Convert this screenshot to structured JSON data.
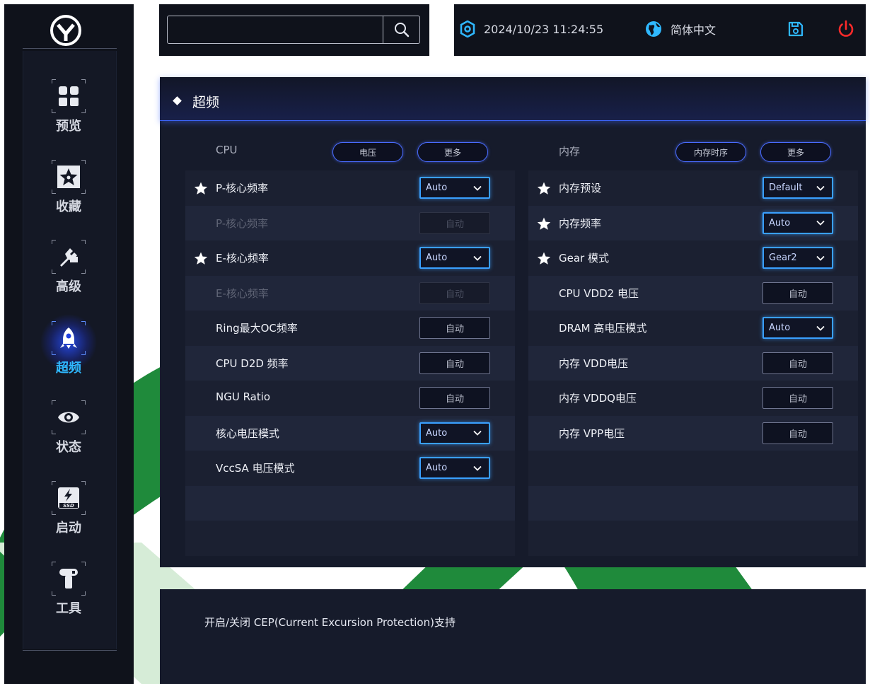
{
  "search": {
    "placeholder": "",
    "value": ""
  },
  "status_bar": {
    "datetime": "2024/10/23 11:24:55",
    "language": "简体中文"
  },
  "sidebar": {
    "items": [
      {
        "label": "预览",
        "icon": "dashboard-icon",
        "active": false
      },
      {
        "label": "收藏",
        "icon": "star-icon",
        "active": false
      },
      {
        "label": "高级",
        "icon": "wrench-icon",
        "active": false
      },
      {
        "label": "超频",
        "icon": "rocket-icon",
        "active": true
      },
      {
        "label": "状态",
        "icon": "eye-icon",
        "active": false
      },
      {
        "label": "启动",
        "icon": "ssd-boot-icon",
        "active": false
      },
      {
        "label": "工具",
        "icon": "tools-icon",
        "active": false
      }
    ]
  },
  "panel": {
    "title": "超频"
  },
  "cpu": {
    "title": "CPU",
    "btn_voltage": "电压",
    "btn_more": "更多",
    "rows": [
      {
        "label": "P-核心频率",
        "star": true,
        "disabled": false,
        "control": "select",
        "value": "Auto"
      },
      {
        "label": "P-核心频率",
        "star": false,
        "disabled": true,
        "control": "button",
        "value": "自动"
      },
      {
        "label": "E-核心频率",
        "star": true,
        "disabled": false,
        "control": "select",
        "value": "Auto"
      },
      {
        "label": "E-核心频率",
        "star": false,
        "disabled": true,
        "control": "button",
        "value": "自动"
      },
      {
        "label": "Ring最大OC频率",
        "star": false,
        "disabled": false,
        "control": "button",
        "value": "自动"
      },
      {
        "label": "CPU D2D 频率",
        "star": false,
        "disabled": false,
        "control": "button",
        "value": "自动"
      },
      {
        "label": "NGU Ratio",
        "star": false,
        "disabled": false,
        "control": "button",
        "value": "自动"
      },
      {
        "label": "核心电压模式",
        "star": false,
        "disabled": false,
        "control": "select",
        "value": "Auto"
      },
      {
        "label": "VccSA 电压模式",
        "star": false,
        "disabled": false,
        "control": "select",
        "value": "Auto"
      },
      {
        "label": "",
        "star": false,
        "disabled": false,
        "control": "none",
        "value": ""
      },
      {
        "label": "",
        "star": false,
        "disabled": false,
        "control": "none",
        "value": ""
      }
    ]
  },
  "memory": {
    "title": "内存",
    "btn_timing": "内存时序",
    "btn_more": "更多",
    "rows": [
      {
        "label": "内存预设",
        "star": true,
        "disabled": false,
        "control": "select",
        "value": "Default"
      },
      {
        "label": "内存频率",
        "star": true,
        "disabled": false,
        "control": "select",
        "value": "Auto"
      },
      {
        "label": "Gear 模式",
        "star": true,
        "disabled": false,
        "control": "select",
        "value": "Gear2"
      },
      {
        "label": "CPU VDD2 电压",
        "star": false,
        "disabled": false,
        "control": "button",
        "value": "自动"
      },
      {
        "label": "DRAM 高电压模式",
        "star": false,
        "disabled": false,
        "control": "select",
        "value": "Auto"
      },
      {
        "label": "内存 VDD电压",
        "star": false,
        "disabled": false,
        "control": "button",
        "value": "自动"
      },
      {
        "label": "内存 VDDQ电压",
        "star": false,
        "disabled": false,
        "control": "button",
        "value": "自动"
      },
      {
        "label": "内存 VPP电压",
        "star": false,
        "disabled": false,
        "control": "button",
        "value": "自动"
      },
      {
        "label": "",
        "star": false,
        "disabled": false,
        "control": "none",
        "value": ""
      },
      {
        "label": "",
        "star": false,
        "disabled": false,
        "control": "none",
        "value": ""
      },
      {
        "label": "",
        "star": false,
        "disabled": false,
        "control": "none",
        "value": ""
      }
    ]
  },
  "description": "开启/关闭 CEP(Current Excursion Protection)支持",
  "colors": {
    "accent": "#3aa0ff",
    "active_nav": "#2fb8ff",
    "power": "#ff2a2a",
    "watermark": "#1f8a3b"
  }
}
